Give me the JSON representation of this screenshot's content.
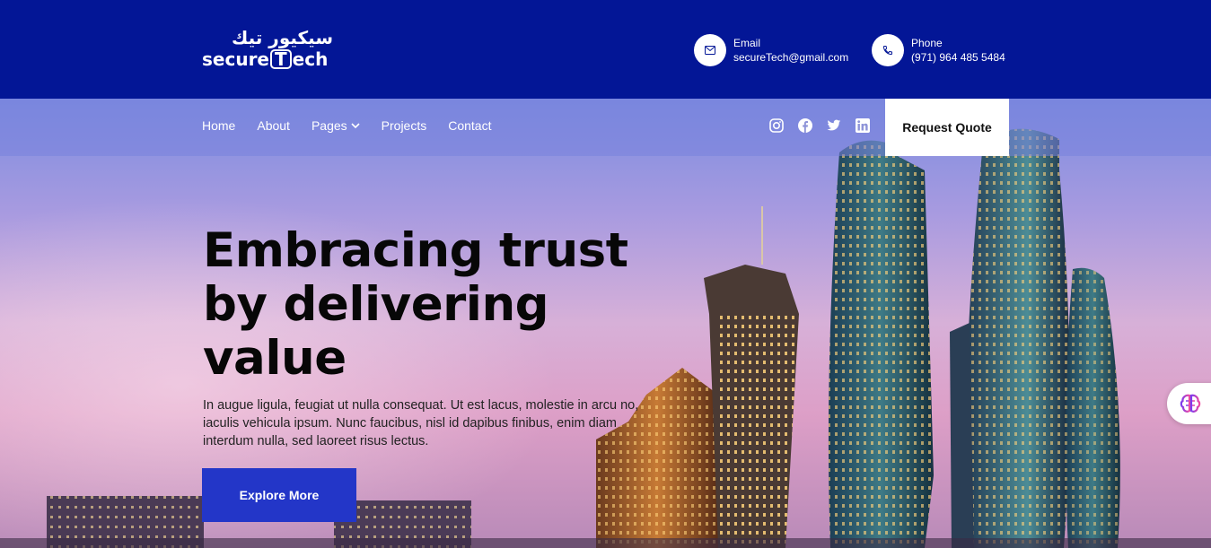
{
  "header": {
    "logo_arabic": "سيكيور تيك",
    "logo_pre": "secure",
    "logo_t": "T",
    "logo_post": "ech",
    "email": {
      "label": "Email",
      "value": "secureTech@gmail.com",
      "icon": "mail-icon"
    },
    "phone": {
      "label": "Phone",
      "value": "(971) 964 485 5484",
      "icon": "phone-icon"
    }
  },
  "nav": {
    "items": [
      {
        "label": "Home"
      },
      {
        "label": "About"
      },
      {
        "label": "Pages",
        "has_dropdown": true
      },
      {
        "label": "Projects"
      },
      {
        "label": "Contact"
      }
    ],
    "socials": [
      "instagram-icon",
      "facebook-icon",
      "twitter-icon",
      "linkedin-icon"
    ],
    "quote_button": "Request Quote"
  },
  "hero": {
    "headline_line1": "Embracing trust",
    "headline_line2": "by delivering",
    "headline_line3": "value",
    "subtext": "In augue ligula, feugiat ut nulla consequat. Ut est lacus, molestie in arcu no, iaculis vehicula ipsum. Nunc faucibus, nisl id dapibus finibus, enim diam interdum nulla, sed laoreet risus lectus.",
    "cta": "Explore More"
  },
  "colors": {
    "topbar": "#031696",
    "cta": "#2336c8",
    "headline": "#070707"
  }
}
